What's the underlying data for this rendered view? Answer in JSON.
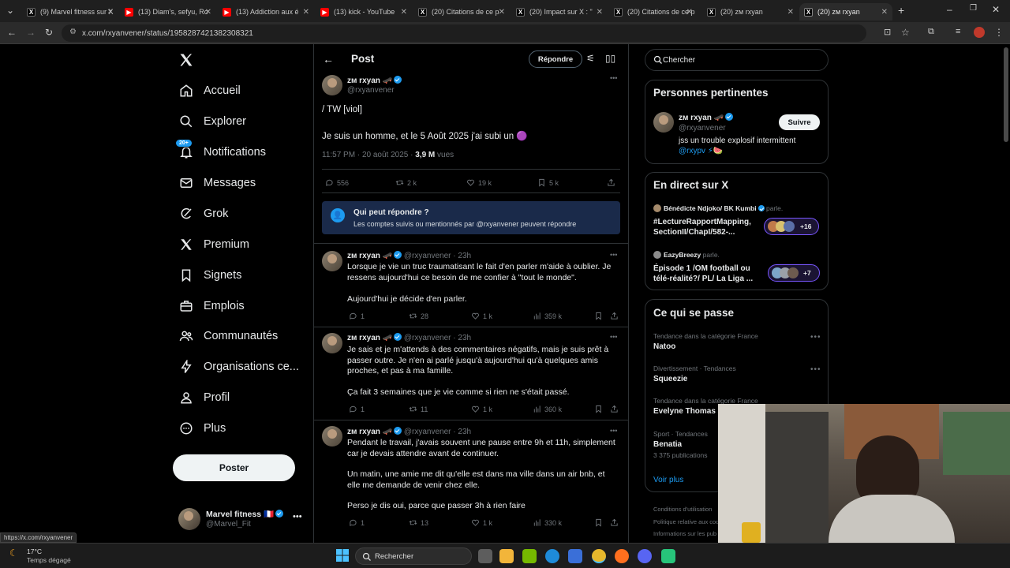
{
  "browser": {
    "tabs": [
      {
        "label": "(9) Marvel fitness sur X",
        "icon": "x-logo",
        "color": "#ffffff"
      },
      {
        "label": "(13) Diam's, sefyu, Ro",
        "icon": "youtube-logo",
        "color": "#ff0000"
      },
      {
        "label": "(13) Addiction aux é",
        "icon": "youtube-logo",
        "color": "#ff0000"
      },
      {
        "label": "(13) kick - YouTube",
        "icon": "youtube-logo",
        "color": "#ff0000"
      },
      {
        "label": "(20) Citations de ce p",
        "icon": "x-logo",
        "color": "#ffffff"
      },
      {
        "label": "(20) Impact sur X : \"",
        "icon": "x-logo",
        "color": "#ffffff"
      },
      {
        "label": "(20) Citations de ce p",
        "icon": "x-logo",
        "color": "#ffffff"
      },
      {
        "label": "(20) zᴍ rxyan",
        "icon": "x-logo",
        "color": "#ffffff"
      },
      {
        "label": "(20) zᴍ rxyan",
        "icon": "x-logo",
        "color": "#ffffff"
      }
    ],
    "url": "x.com/rxyanvener/status/1958287421382308321",
    "status_url": "https://x.com/rxyanvener"
  },
  "nav": {
    "items": [
      {
        "label": "Accueil",
        "icon": "home-icon"
      },
      {
        "label": "Explorer",
        "icon": "search-icon"
      },
      {
        "label": "Notifications",
        "icon": "bell-icon",
        "badge": "20+"
      },
      {
        "label": "Messages",
        "icon": "mail-icon"
      },
      {
        "label": "Grok",
        "icon": "grok-icon"
      },
      {
        "label": "Premium",
        "icon": "x-logo-icon"
      },
      {
        "label": "Signets",
        "icon": "bookmark-icon"
      },
      {
        "label": "Emplois",
        "icon": "briefcase-icon"
      },
      {
        "label": "Communautés",
        "icon": "people-icon"
      },
      {
        "label": "Organisations ce...",
        "icon": "lightning-icon"
      },
      {
        "label": "Profil",
        "icon": "person-icon"
      },
      {
        "label": "Plus",
        "icon": "more-circle-icon"
      }
    ],
    "post_button": "Poster",
    "account": {
      "name": "Marvel fitness 🇫🇷",
      "handle": "@Marvel_Fit"
    }
  },
  "header": {
    "title": "Post",
    "reply_button": "Répondre"
  },
  "main_post": {
    "author": "zᴍ rxyan 🛹",
    "handle": "@rxyanvener",
    "line1": "/ TW [viol]",
    "line2": "Je suis un homme, et le 5 Août 2025 j'ai subi un 🟣",
    "timestamp": "11:57 PM · 20 août 2025 · ",
    "views": "3,9 M",
    "views_label": " vues",
    "stats": {
      "replies": "556",
      "reposts": "2 k",
      "likes": "19 k",
      "bookmarks": "5 k"
    }
  },
  "reply_restriction": {
    "title": "Qui peut répondre ?",
    "text": "Les comptes suivis ou mentionnés par @rxyanvener peuvent répondre"
  },
  "replies": [
    {
      "author": "zᴍ rxyan 🛹",
      "handle": "@rxyanvener · 23h",
      "paragraphs": [
        "Lorsque je vie un truc traumatisant le fait d'en parler m'aide à oublier. Je ressens aujourd'hui ce besoin de me confier à \"tout le monde\".",
        "Aujourd'hui je décide d'en parler."
      ],
      "stats": {
        "replies": "1",
        "reposts": "28",
        "likes": "1 k",
        "views": "359 k"
      }
    },
    {
      "author": "zᴍ rxyan 🛹",
      "handle": "@rxyanvener · 23h",
      "paragraphs": [
        "Je sais et je m'attends à des commentaires négatifs, mais je suis prêt à passer outre. Je n'en ai parlé jusqu'à aujourd'hui qu'à quelques amis proches, et pas à ma famille.",
        "Ça fait 3 semaines que je vie comme si rien ne s'était passé."
      ],
      "stats": {
        "replies": "1",
        "reposts": "11",
        "likes": "1 k",
        "views": "360 k"
      }
    },
    {
      "author": "zᴍ rxyan 🛹",
      "handle": "@rxyanvener · 23h",
      "paragraphs": [
        "Pendant le travail, j'avais souvent une pause entre 9h et 11h, simplement car je devais attendre avant de continuer.",
        "Un matin, une amie me dit qu'elle est dans ma ville dans un air bnb, et elle me demande de venir chez elle.",
        "Perso je dis oui, parce que passer 3h à rien faire"
      ],
      "stats": {
        "replies": "1",
        "reposts": "13",
        "likes": "1 k",
        "views": "330 k"
      }
    }
  ],
  "search": {
    "placeholder": "Chercher"
  },
  "relevant": {
    "title": "Personnes pertinentes",
    "name": "zᴍ rxyan 🛹",
    "handle": "@rxyanvener",
    "follow": "Suivre",
    "bio": "jss un trouble explosif intermittent",
    "bio_link": "@rxypv ⚡🍉"
  },
  "live": {
    "title": "En direct sur X",
    "spaces": [
      {
        "host": "Bénédicte Ndjoko/ BK Kumbi",
        "status": "parle.",
        "title": "#LectureRapportMapping, SectionII/ChapI/582-...",
        "count": "+16"
      },
      {
        "host": "EazyBreezy",
        "status": "parle.",
        "title": "Épisode 1 /OM football ou télé-réalité?/ PL/ La Liga ...",
        "count": "+7"
      }
    ]
  },
  "trends": {
    "title": "Ce qui se passe",
    "items": [
      {
        "category": "Tendance dans la catégorie France",
        "name": "Natoo"
      },
      {
        "category": "Divertissement · Tendances",
        "name": "Squeezie"
      },
      {
        "category": "Tendance dans la catégorie France",
        "name": "Evelyne Thomas"
      },
      {
        "category": "Sport · Tendances",
        "name": "Benatia",
        "count": "3 375 publications"
      }
    ],
    "show_more": "Voir plus",
    "footer": [
      "Conditions d'utilisation",
      "Politique relative aux coo",
      "Informations sur les pub"
    ]
  },
  "taskbar": {
    "weather_temp": "17°C",
    "weather_desc": "Temps dégagé",
    "search": "Rechercher"
  },
  "colors": {
    "accent": "#1d9bf0",
    "restriction_bg": "#1a2a4a",
    "background": "#000000"
  }
}
